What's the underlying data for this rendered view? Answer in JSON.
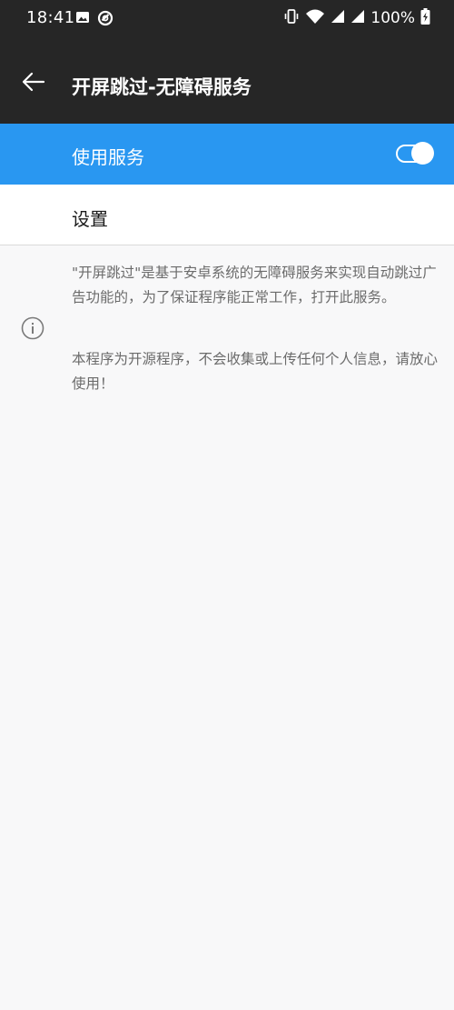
{
  "status_bar": {
    "time": "18:41",
    "battery": "100%",
    "icons": [
      "image-icon",
      "no-disturb-icon",
      "vibrate-icon",
      "wifi-icon",
      "signal-icon",
      "signal-icon",
      "battery-charging-icon"
    ]
  },
  "app_bar": {
    "title": "开屏跳过-无障碍服务"
  },
  "service": {
    "label": "使用服务",
    "enabled": true
  },
  "settings": {
    "label": "设置"
  },
  "info": {
    "paragraph1": "\"开屏跳过\"是基于安卓系统的无障碍服务来实现自动跳过广告功能的，为了保证程序能正常工作，打开此服务。",
    "paragraph2": "本程序为开源程序，不会收集或上传任何个人信息，请放心使用！"
  },
  "colors": {
    "header_bg": "#262626",
    "accent": "#2997f1",
    "page_bg": "#f8f8f9"
  }
}
